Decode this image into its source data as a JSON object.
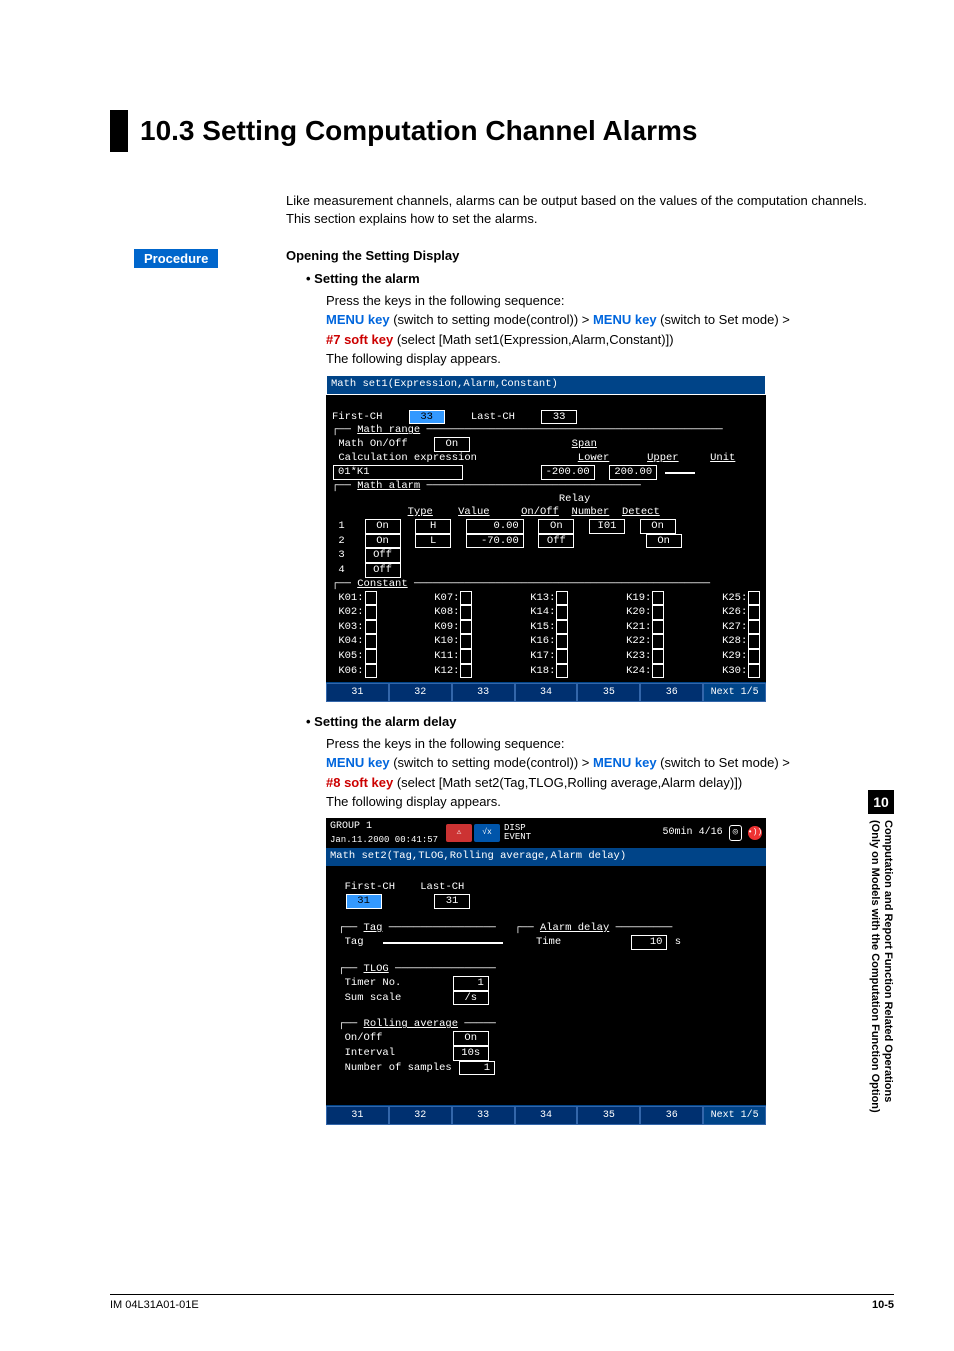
{
  "title": "10.3  Setting Computation Channel Alarms",
  "intro": "Like measurement channels, alarms can be output based on the values of the computation channels.  This section explains how to set the alarms.",
  "procedure_label": "Procedure",
  "opening_heading": "Opening the Setting Display",
  "alarm": {
    "heading": "Setting the alarm",
    "press_line": "Press the keys in the following sequence:",
    "menu_key": "MENU key",
    "menu_key_desc1": " (switch to setting mode(control)) > ",
    "menu_key_desc2": " (switch to Set mode) > ",
    "soft_key": "#7 soft key",
    "soft_key_desc": " (select [Math set1(Expression,Alarm,Constant)])",
    "following_line": "The following display appears."
  },
  "delay": {
    "heading": "Setting the alarm delay",
    "press_line": "Press the keys in the following sequence:",
    "menu_key": "MENU key",
    "menu_key_desc1": " (switch to setting mode(control)) > ",
    "menu_key_desc2": " (switch to Set mode) > ",
    "soft_key": "#8 soft key",
    "soft_key_desc": " (select [Math set2(Tag,TLOG,Rolling average,Alarm delay)])",
    "following_line": "The following display appears."
  },
  "screen1": {
    "title": "Math set1(Expression,Alarm,Constant)",
    "first_ch_label": "First-CH",
    "first_ch_val": "33",
    "last_ch_label": "Last-CH",
    "last_ch_val": "33",
    "range_section": "Math range",
    "onoff_label": "Math On/Off",
    "onoff_val": "On",
    "calc_label": "Calculation expression",
    "calc_val": "01*K1",
    "span_label": "Span",
    "lower_label": "Lower",
    "upper_label": "Upper",
    "unit_label": "Unit",
    "lower_val": "-200.00",
    "upper_val": "200.00",
    "unit_val": "",
    "alarm_section": "Math alarm",
    "hdr_type": "Type",
    "hdr_value": "Value",
    "hdr_relay": "Relay\nOn/Off",
    "hdr_number": "Number",
    "hdr_detect": "Detect",
    "rows": [
      {
        "n": "1",
        "on": "On",
        "type": "H",
        "value": "0.00",
        "relay": "On",
        "number": "I01",
        "detect": "On"
      },
      {
        "n": "2",
        "on": "On",
        "type": "L",
        "value": "-70.00",
        "relay": "Off",
        "number": "",
        "detect": "On"
      },
      {
        "n": "3",
        "on": "Off",
        "type": "",
        "value": "",
        "relay": "",
        "number": "",
        "detect": ""
      },
      {
        "n": "4",
        "on": "Off",
        "type": "",
        "value": "",
        "relay": "",
        "number": "",
        "detect": ""
      }
    ],
    "const_section": "Constant",
    "constants": [
      [
        "K01:",
        "K07:",
        "K13:",
        "K19:",
        "K25:"
      ],
      [
        "K02:",
        "K08:",
        "K14:",
        "K20:",
        "K26:"
      ],
      [
        "K03:",
        "K09:",
        "K15:",
        "K21:",
        "K27:"
      ],
      [
        "K04:",
        "K10:",
        "K16:",
        "K22:",
        "K28:"
      ],
      [
        "K05:",
        "K11:",
        "K17:",
        "K23:",
        "K29:"
      ],
      [
        "K06:",
        "K12:",
        "K18:",
        "K24:",
        "K30:"
      ]
    ],
    "softkeys": [
      "31",
      "32",
      "33",
      "34",
      "35",
      "36",
      "Next 1/5"
    ]
  },
  "screen2": {
    "group": "GROUP 1",
    "datetime": "Jan.11.2000 00:41:57",
    "disp_label": "DISP",
    "event_label": "EVENT",
    "time_chip": "50min",
    "page_chip": "4/16",
    "title": "Math set2(Tag,TLOG,Rolling average,Alarm delay)",
    "first_ch_label": "First-CH",
    "first_ch_val": "31",
    "last_ch_label": "Last-CH",
    "last_ch_val": "31",
    "tag_section": "Tag",
    "tag_label": "Tag",
    "tag_val": "",
    "delay_section": "Alarm delay",
    "time_label": "Time",
    "time_val": "10",
    "time_unit": "s",
    "tlog_section": "TLOG",
    "timer_label": "Timer No.",
    "timer_val": "1",
    "sum_label": "Sum scale",
    "sum_val": "/s",
    "roll_section": "Rolling average",
    "roll_onoff_label": "On/Off",
    "roll_onoff_val": "On",
    "interval_label": "Interval",
    "interval_val": "10s",
    "samples_label": "Number of samples",
    "samples_val": "1",
    "softkeys": [
      "31",
      "32",
      "33",
      "34",
      "35",
      "36",
      "Next 1/5"
    ]
  },
  "side_tab": {
    "num": "10",
    "line1": "Computation and Report Function Related Operations",
    "line2": "(Only on Models with the Computation Function Option)"
  },
  "footer": {
    "left": "IM 04L31A01-01E",
    "right": "10-5"
  }
}
